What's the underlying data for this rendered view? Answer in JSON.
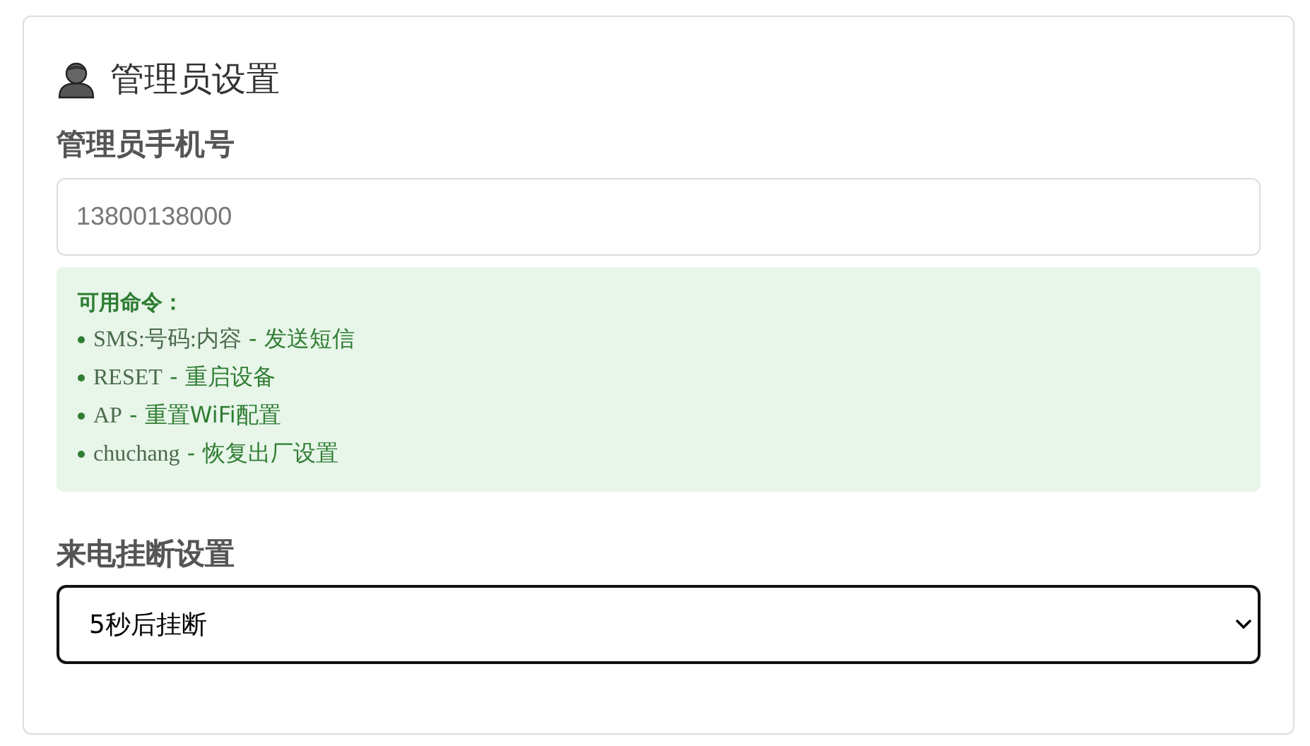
{
  "section": {
    "title": "管理员设置"
  },
  "phone": {
    "label": "管理员手机号",
    "placeholder": "13800138000"
  },
  "help": {
    "title": "可用命令：",
    "commands": [
      {
        "code": "SMS:号码:内容",
        "description": "- 发送短信"
      },
      {
        "code": "RESET",
        "description": "- 重启设备"
      },
      {
        "code": "AP",
        "description": "- 重置WiFi配置"
      },
      {
        "code": "chuchang",
        "description": "- 恢复出厂设置"
      }
    ]
  },
  "hangup": {
    "label": "来电挂断设置",
    "value": "5秒后挂断",
    "focused": true
  }
}
